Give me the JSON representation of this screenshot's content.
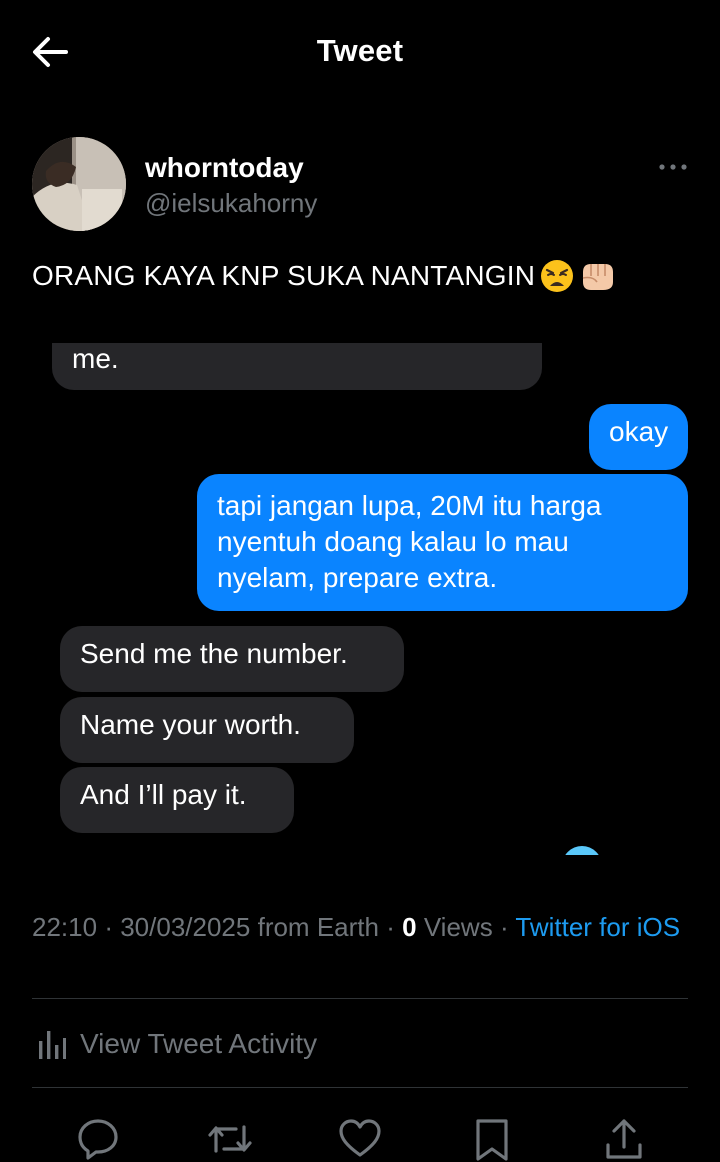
{
  "header": {
    "title": "Tweet",
    "back_icon": "arrow-left-icon"
  },
  "author": {
    "display_name": "whorntoday",
    "handle": "@ielsukahorny",
    "more_icon": "more-horizontal-icon"
  },
  "tweet": {
    "text": "ORANG KAYA KNP SUKA NANTANGIN",
    "emojis": [
      "weary-face-emoji",
      "oncoming-fist-emoji"
    ]
  },
  "media": {
    "messages": [
      {
        "side": "received",
        "text": "me."
      },
      {
        "side": "sent",
        "text": "okay"
      },
      {
        "side": "sent",
        "text": "tapi jangan lupa, 20M itu harga\nnyentuh doang kalau lo mau\nnyelam, prepare extra."
      },
      {
        "side": "received",
        "text": "Send me the number."
      },
      {
        "side": "received",
        "text": "Name your worth."
      },
      {
        "side": "received",
        "text": "And I’ll pay it."
      }
    ]
  },
  "meta": {
    "time": "22:10",
    "date": "30/03/2025",
    "location": "from Earth",
    "views_count": "0",
    "views_label": "Views",
    "source": "Twitter for iOS",
    "separator": "·"
  },
  "activity": {
    "label": "View Tweet Activity",
    "icon": "bar-chart-icon"
  },
  "actions": [
    {
      "name": "reply",
      "icon": "reply-icon"
    },
    {
      "name": "retweet",
      "icon": "retweet-icon"
    },
    {
      "name": "like",
      "icon": "heart-icon"
    },
    {
      "name": "bookmark",
      "icon": "bookmark-icon"
    },
    {
      "name": "share",
      "icon": "share-icon"
    }
  ],
  "colors": {
    "background": "#000000",
    "secondary_text": "#71767b",
    "link": "#1d9bf0",
    "sent_bubble": "#0a84ff",
    "received_bubble": "#262629",
    "divider": "#2f3336"
  }
}
